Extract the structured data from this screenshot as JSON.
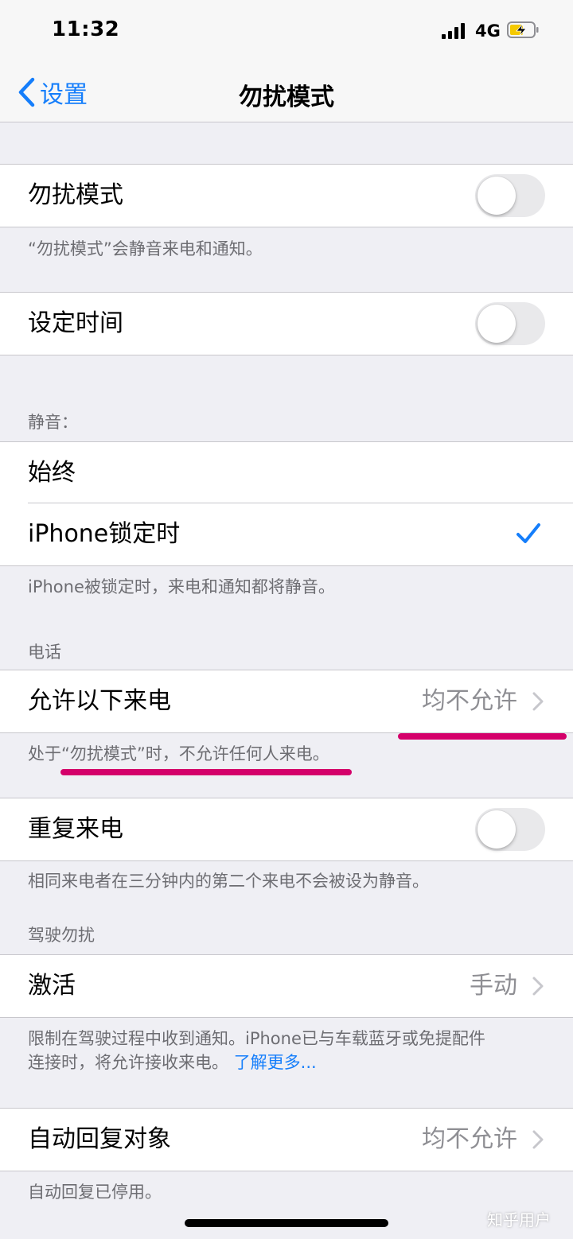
{
  "status": {
    "time": "11:32",
    "network": "4G"
  },
  "nav": {
    "back_label": "设置",
    "title": "勿扰模式"
  },
  "dnd": {
    "label": "勿扰模式",
    "on": false,
    "footer": "“勿扰模式”会静音来电和通知。"
  },
  "scheduled": {
    "label": "设定时间",
    "on": false
  },
  "silence": {
    "header": "静音：",
    "options": [
      "始终",
      "iPhone锁定时"
    ],
    "selected": "iPhone锁定时",
    "footer": "iPhone被锁定时，来电和通知都将静音。"
  },
  "phone": {
    "header": "电话",
    "allow_calls_label": "允许以下来电",
    "allow_calls_value": "均不允许",
    "footer": "处于“勿扰模式”时，不允许任何人来电。",
    "repeated_label": "重复来电",
    "repeated_on": false,
    "repeated_footer": "相同来电者在三分钟内的第二个来电不会被设为静音。"
  },
  "driving": {
    "header": "驾驶勿扰",
    "activate_label": "激活",
    "activate_value": "手动",
    "footer_line1": "限制在驾驶过程中收到通知。iPhone已与车载蓝牙或免提配件",
    "footer_line2": "连接时，将允许接收来电。",
    "learn_more": "了解更多...",
    "auto_reply_label": "自动回复对象",
    "auto_reply_value": "均不允许",
    "auto_reply_footer": "自动回复已停用。"
  },
  "watermark": "知乎用户",
  "colors": {
    "accent": "#157efb",
    "annotation": "#d4006a",
    "background": "#efeff4"
  }
}
